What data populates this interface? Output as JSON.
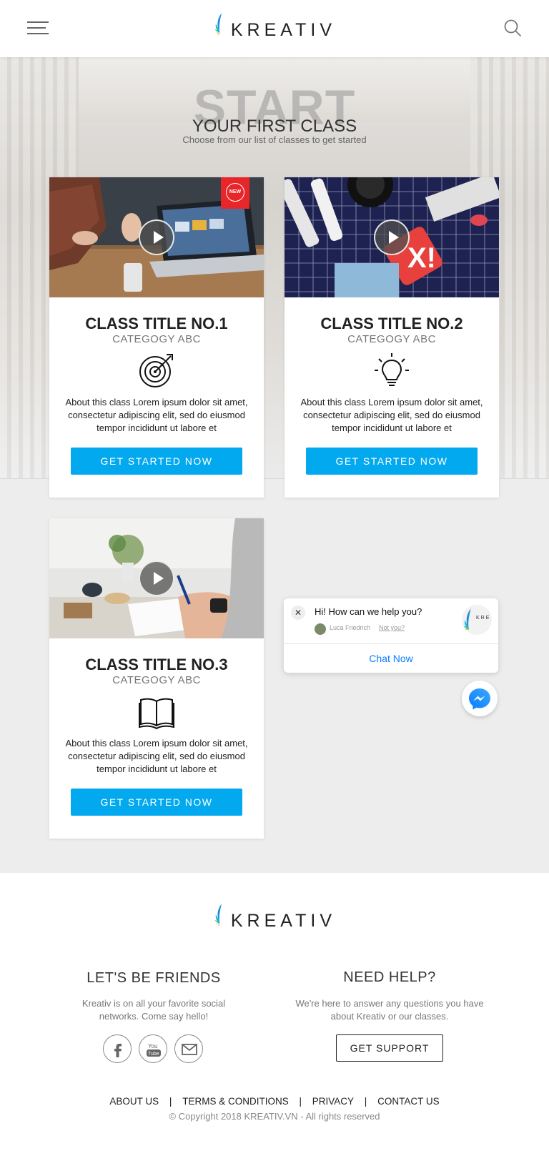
{
  "header": {
    "brand": "KREATIV",
    "menu_icon": "hamburger-menu-icon",
    "search_icon": "search-icon"
  },
  "hero": {
    "big_word": "START",
    "title": "YOUR FIRST CLASS",
    "subtitle": "Choose from our list of classes to get started"
  },
  "classes": [
    {
      "title": "CLASS TITLE NO.1",
      "category": "CATEGOGY ABC",
      "icon": "target-icon",
      "description": "About this class Lorem ipsum dolor sit amet, consectetur adipiscing elit, sed do eiusmod tempor incididunt ut labore et",
      "button": "GET STARTED NOW",
      "badge": "NEW"
    },
    {
      "title": "CLASS TITLE NO.2",
      "category": "CATEGOGY ABC",
      "icon": "lightbulb-icon",
      "description": "About this class Lorem ipsum dolor sit amet, consectetur adipiscing elit, sed do eiusmod tempor incididunt ut labore et",
      "button": "GET STARTED NOW"
    },
    {
      "title": "CLASS TITLE NO.3",
      "category": "CATEGOGY ABC",
      "icon": "open-book-icon",
      "description": "About this class Lorem ipsum dolor sit amet, consectetur adipiscing elit, sed do eiusmod tempor incididunt ut labore et",
      "button": "GET STARTED NOW"
    }
  ],
  "chat": {
    "question": "Hi! How can we help you?",
    "agent": "Luca Friedrich",
    "not_you": "Not you?",
    "cta": "Chat Now",
    "brand_short": "KRE"
  },
  "footer": {
    "brand": "KREATIV",
    "friends": {
      "heading": "LET'S BE FRIENDS",
      "text": "Kreativ is on all your favorite social networks. Come say hello!",
      "icons": [
        "facebook-icon",
        "youtube-icon",
        "mail-icon"
      ]
    },
    "help": {
      "heading": "NEED HELP?",
      "text": "We're here to answer any questions you have about Kreativ or our classes.",
      "button": "GET SUPPORT"
    },
    "links": [
      "ABOUT US",
      "TERMS & CONDITIONS",
      "PRIVACY",
      "CONTACT US"
    ],
    "separator": "|",
    "copyright": "© Copyright 2018 KREATIV.VN - All rights reserved"
  },
  "colors": {
    "accent": "#03a9ef",
    "badge": "#e8262a",
    "chat_link": "#0a7cff"
  }
}
